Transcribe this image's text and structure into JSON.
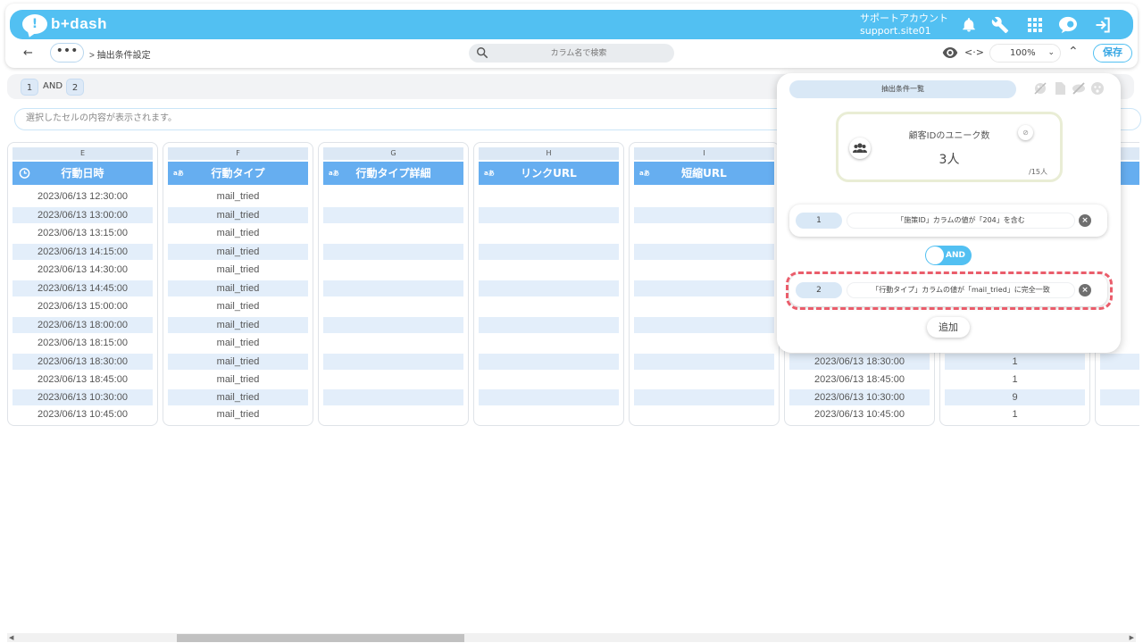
{
  "app": {
    "logo_text": "b+dash"
  },
  "account": {
    "name": "サポートアカウント",
    "site": "support.site01"
  },
  "toolbar": {
    "back_icon": "←",
    "dots": "•••",
    "breadcrumb": "> 抽出条件設定",
    "search_placeholder": "カラム名で検索",
    "code_icon": "<·>",
    "zoom": "100%",
    "save": "保存"
  },
  "condition_row": {
    "chip1": "1",
    "and": "AND",
    "chip2": "2"
  },
  "cell_preview": "選択したセルの内容が表示されます。",
  "columns": [
    {
      "letter": "E",
      "header": "行動日時",
      "icon": "clock-icon",
      "rows": [
        "2023/06/13 12:30:00",
        "2023/06/13 13:00:00",
        "2023/06/13 13:15:00",
        "2023/06/13 14:15:00",
        "2023/06/13 14:30:00",
        "2023/06/13 14:45:00",
        "2023/06/13 15:00:00",
        "2023/06/13 18:00:00",
        "2023/06/13 18:15:00",
        "2023/06/13 18:30:00",
        "2023/06/13 18:45:00",
        "2023/06/13 10:30:00",
        "2023/06/13 10:45:00"
      ]
    },
    {
      "letter": "F",
      "header": "行動タイプ",
      "icon": "text-type-icon",
      "type_label": "aあ",
      "rows": [
        "mail_tried",
        "mail_tried",
        "mail_tried",
        "mail_tried",
        "mail_tried",
        "mail_tried",
        "mail_tried",
        "mail_tried",
        "mail_tried",
        "mail_tried",
        "mail_tried",
        "mail_tried",
        "mail_tried"
      ]
    },
    {
      "letter": "G",
      "header": "行動タイプ詳細",
      "icon": "text-type-icon",
      "type_label": "aあ",
      "rows": []
    },
    {
      "letter": "H",
      "header": "リンクURL",
      "icon": "text-type-icon",
      "type_label": "aあ",
      "rows": []
    },
    {
      "letter": "I",
      "header": "短縮URL",
      "icon": "text-type-icon",
      "type_label": "aあ",
      "rows": []
    },
    {
      "letter": "",
      "header": "",
      "rows": [
        "2023/06/13 18:30:00",
        "2023/06/13 18:45:00",
        "2023/06/13 10:30:00",
        "2023/06/13 10:45:00"
      ]
    },
    {
      "letter": "",
      "header": "",
      "rows": [
        "1",
        "1",
        "9",
        "1"
      ]
    }
  ],
  "panel": {
    "tab_label": "抽出条件一覧",
    "unique": {
      "title": "顧客IDのユニーク数",
      "value": "3人",
      "total": "/15人"
    },
    "conditions": [
      {
        "num": "1",
        "text": "「施策ID」カラムの値が「204」を含む"
      },
      {
        "num": "2",
        "text": "「行動タイプ」カラムの値が「mail_tried」に完全一致"
      }
    ],
    "and_toggle": "AND",
    "add_button": "追加"
  },
  "colors": {
    "brand": "#52c0f2",
    "header_blue": "#66aef0",
    "highlight": "#ea5d6b"
  }
}
